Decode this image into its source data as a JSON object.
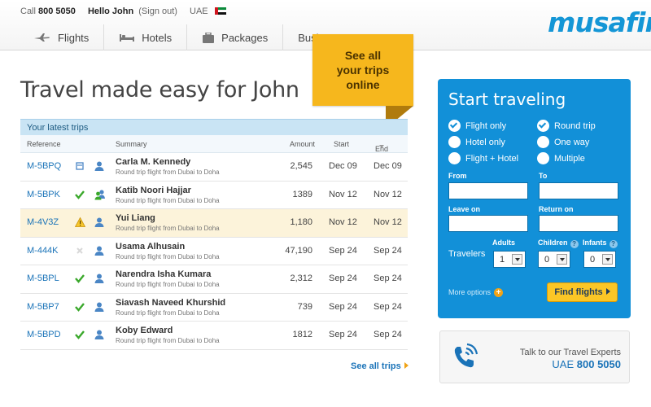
{
  "header": {
    "call_label": "Call",
    "phone": "800 5050",
    "greeting": "Hello John",
    "signout": "(Sign out)",
    "country": "UAE",
    "logo": "musafir"
  },
  "nav": {
    "tabs": [
      {
        "label": "Flights",
        "icon": "plane-icon"
      },
      {
        "label": "Hotels",
        "icon": "bed-icon"
      },
      {
        "label": "Packages",
        "icon": "suitcase-icon"
      },
      {
        "label": "Business",
        "icon": ""
      }
    ]
  },
  "main": {
    "title": "Travel made easy for John",
    "callout": [
      "See all",
      "your trips",
      "online"
    ]
  },
  "trips": {
    "heading": "Your latest trips",
    "columns": {
      "reference": "Reference",
      "summary": "Summary",
      "amount": "Amount",
      "start": "Start",
      "end": "End"
    },
    "rows": [
      {
        "ref": "M-5BPQ",
        "status": "document-icon",
        "name": "Carla M. Kennedy",
        "summary": "Round trip flight from Dubai to Doha",
        "amount": "2,545",
        "start": "Dec 09",
        "end": "Dec 09",
        "highlight": false
      },
      {
        "ref": "M-5BPK",
        "status": "check-icon",
        "name": "Katib Noori Hajjar",
        "summary": "Round trip flight from Dubai to Doha",
        "amount": "1389",
        "start": "Nov 12",
        "end": "Nov 12",
        "highlight": false
      },
      {
        "ref": "M-4V3Z",
        "status": "warning-icon",
        "name": "Yui Liang",
        "summary": "Round trip flight from Dubai to Doha",
        "amount": "1,180",
        "start": "Nov 12",
        "end": "Nov 12",
        "highlight": true
      },
      {
        "ref": "M-444K",
        "status": "cancelled-icon",
        "name": "Usama Alhusain",
        "summary": "Round trip flight from Dubai to Doha",
        "amount": "47,190",
        "start": "Sep 24",
        "end": "Sep 24",
        "highlight": false
      },
      {
        "ref": "M-5BPL",
        "status": "check-icon",
        "name": "Narendra Isha Kumara",
        "summary": "Round trip flight from Dubai to Doha",
        "amount": "2,312",
        "start": "Sep 24",
        "end": "Sep 24",
        "highlight": false
      },
      {
        "ref": "M-5BP7",
        "status": "check-icon",
        "name": "Siavash Naveed Khurshid",
        "summary": "Round trip flight from Dubai to Doha",
        "amount": "739",
        "start": "Sep 24",
        "end": "Sep 24",
        "highlight": false
      },
      {
        "ref": "M-5BPD",
        "status": "check-icon",
        "name": "Koby Edward",
        "summary": "Round trip flight from Dubai to Doha",
        "amount": "1812",
        "start": "Sep 24",
        "end": "Sep 24",
        "highlight": false
      }
    ],
    "see_all": "See all trips"
  },
  "search": {
    "title": "Start traveling",
    "options_left": [
      {
        "label": "Flight only",
        "checked": true
      },
      {
        "label": "Hotel only",
        "checked": false
      },
      {
        "label": "Flight + Hotel",
        "checked": false
      }
    ],
    "options_right": [
      {
        "label": "Round trip",
        "checked": true
      },
      {
        "label": "One way",
        "checked": false
      },
      {
        "label": "Multiple",
        "checked": false
      }
    ],
    "from_label": "From",
    "to_label": "To",
    "leave_label": "Leave on",
    "return_label": "Return on",
    "travelers_label": "Travelers",
    "adults_label": "Adults",
    "children_label": "Children",
    "infants_label": "Infants",
    "adults_value": "1",
    "children_value": "0",
    "infants_value": "0",
    "more_options": "More options",
    "find_button": "Find flights"
  },
  "experts": {
    "line1": "Talk to our Travel Experts",
    "country": "UAE",
    "phone": "800 5050"
  },
  "colors": {
    "accent": "#1290d8",
    "callout": "#f6b71d",
    "button": "#fbc626",
    "link": "#1a73b8",
    "check": "#3aa82b"
  }
}
